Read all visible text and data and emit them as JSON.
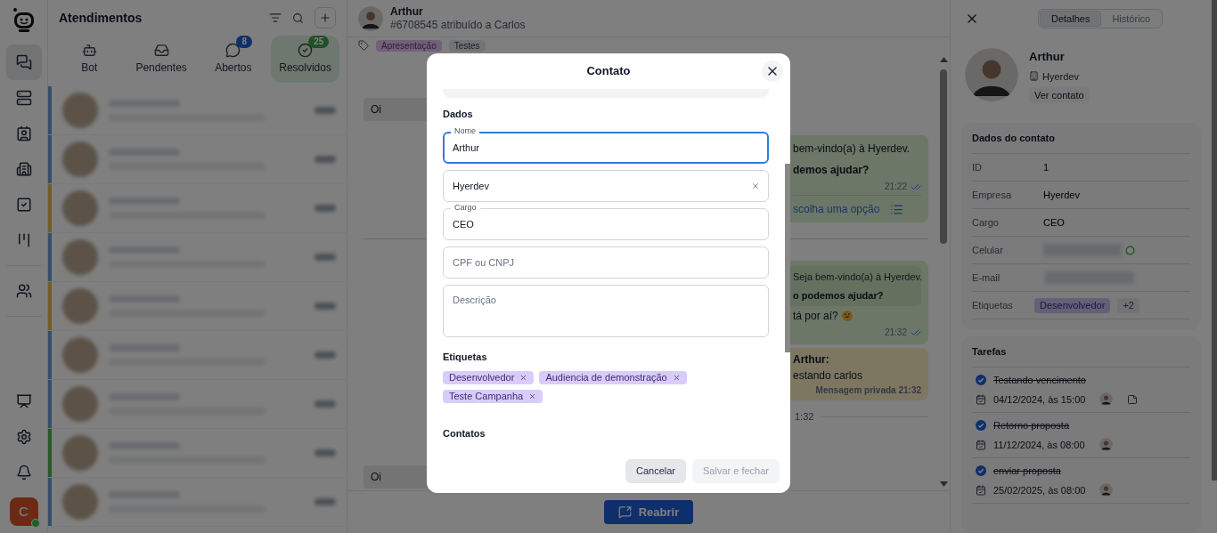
{
  "rail": {
    "groups": [
      [
        {
          "kind": "chat",
          "selected": true
        },
        {
          "kind": "server",
          "selected": false
        },
        {
          "kind": "contact",
          "selected": false
        },
        {
          "kind": "building",
          "selected": false
        },
        {
          "kind": "tasks",
          "selected": false
        },
        {
          "kind": "kanban",
          "selected": false
        }
      ],
      [
        {
          "kind": "users",
          "selected": false
        }
      ]
    ],
    "bottom_items": [
      {
        "kind": "presentation",
        "selected": false
      },
      {
        "kind": "settings",
        "selected": false
      },
      {
        "kind": "bell",
        "selected": false
      }
    ],
    "user": {
      "initial": "C",
      "online": true
    }
  },
  "list": {
    "title": "Atendimentos",
    "tabs": [
      {
        "kind": "bot",
        "label": "Bot",
        "selected": false
      },
      {
        "kind": "inbox",
        "label": "Pendentes",
        "selected": false
      },
      {
        "kind": "chat",
        "label": "Abertos",
        "selected": false,
        "badge": "8",
        "color": "#0f306b"
      },
      {
        "kind": "done",
        "label": "Resolvidos",
        "selected": true,
        "badge": "25",
        "color": "#205227"
      }
    ],
    "conversations": [
      {
        "color": "#364e6c"
      },
      {
        "color": "#364e6c"
      },
      {
        "color": "#735c25"
      },
      {
        "color": "#364e6c"
      },
      {
        "color": "#735c25"
      },
      {
        "color": "#364e6c"
      },
      {
        "color": "#364e6c"
      },
      {
        "color": "#265828"
      },
      {
        "color": "#364e6c"
      }
    ]
  },
  "chat": {
    "contact": "Arthur",
    "subtitle": "#6708545 atribuído a Carlos",
    "tags": [
      "Apresentação",
      "Testes"
    ],
    "messages": [
      {
        "kind": "incoming",
        "text": "Oi"
      },
      {
        "kind": "outgoing",
        "lines": [
          "bem-vindo(a) à Hyerdev."
        ],
        "bold": "demos ajudar?",
        "time": "21:22",
        "read": true,
        "option": "scolha uma opção"
      },
      {
        "kind": "divider"
      },
      {
        "kind": "outgoing",
        "quote": [
          "Seja bem-vindo(a) à Hyerdev."
        ],
        "quote_bold": "o podemos ajudar?",
        "lines": [
          "tá por aí?"
        ],
        "emoji": true,
        "time": "21:32",
        "read": true
      },
      {
        "kind": "private",
        "author": "Arthur:",
        "text": "estando carlos",
        "footer": "Mensagem privada 21:32"
      },
      {
        "kind": "separator",
        "text": "1:32"
      },
      {
        "kind": "incoming",
        "text": "Oi"
      }
    ],
    "action": "Reabrir"
  },
  "details": {
    "tabs": [
      {
        "label": "Detalhes",
        "selected": true
      },
      {
        "label": "Histórico",
        "selected": false
      }
    ],
    "name": "Arthur",
    "company": "Hyerdev",
    "view_button": "Ver contato",
    "contact_card": {
      "title": "Dados do contato",
      "rows": [
        {
          "kind": "text",
          "label": "ID",
          "value": "1"
        },
        {
          "kind": "text",
          "label": "Empresa",
          "value": "Hyerdev"
        },
        {
          "kind": "text",
          "label": "Cargo",
          "value": "CEO"
        },
        {
          "kind": "phone",
          "label": "Celular"
        },
        {
          "kind": "hidden",
          "label": "E-mail"
        },
        {
          "kind": "tags",
          "label": "Etiquetas",
          "tag": "Desenvolvedor",
          "more": "+2"
        }
      ]
    },
    "tasks_card": {
      "title": "Tarefas",
      "tasks": [
        {
          "title": "Testando vencimento",
          "date": "04/12/2024, às 15:00",
          "checked": true,
          "note": true
        },
        {
          "title": "Retorno proposta",
          "date": "11/12/2024, às 08:00",
          "checked": true,
          "note": false
        },
        {
          "title": "enviar proposta",
          "date": "25/02/2025, às 08:00",
          "checked": true,
          "note": false
        }
      ]
    }
  },
  "modal": {
    "title": "Contato",
    "section": "Dados",
    "fields": [
      {
        "kind": "input",
        "label": "Nome",
        "value": "Arthur",
        "focused": true
      },
      {
        "kind": "input",
        "value": "Hyerdev",
        "clearable": true,
        "focused": false
      },
      {
        "kind": "input",
        "label": "Cargo",
        "value": "CEO",
        "focused": false
      },
      {
        "kind": "input",
        "placeholder": "CPF ou CNPJ",
        "focused": false
      },
      {
        "kind": "textarea",
        "placeholder": "Descrição",
        "focused": false
      }
    ],
    "tags_title": "Etiquetas",
    "tags": [
      "Desenvolvedor",
      "Audiencia de demonstração",
      "Teste Campanha"
    ],
    "contacts_title": "Contatos",
    "buttons": [
      {
        "label": "Cancelar",
        "disabled": false
      },
      {
        "label": "Salvar e fechar",
        "disabled": true
      }
    ]
  }
}
